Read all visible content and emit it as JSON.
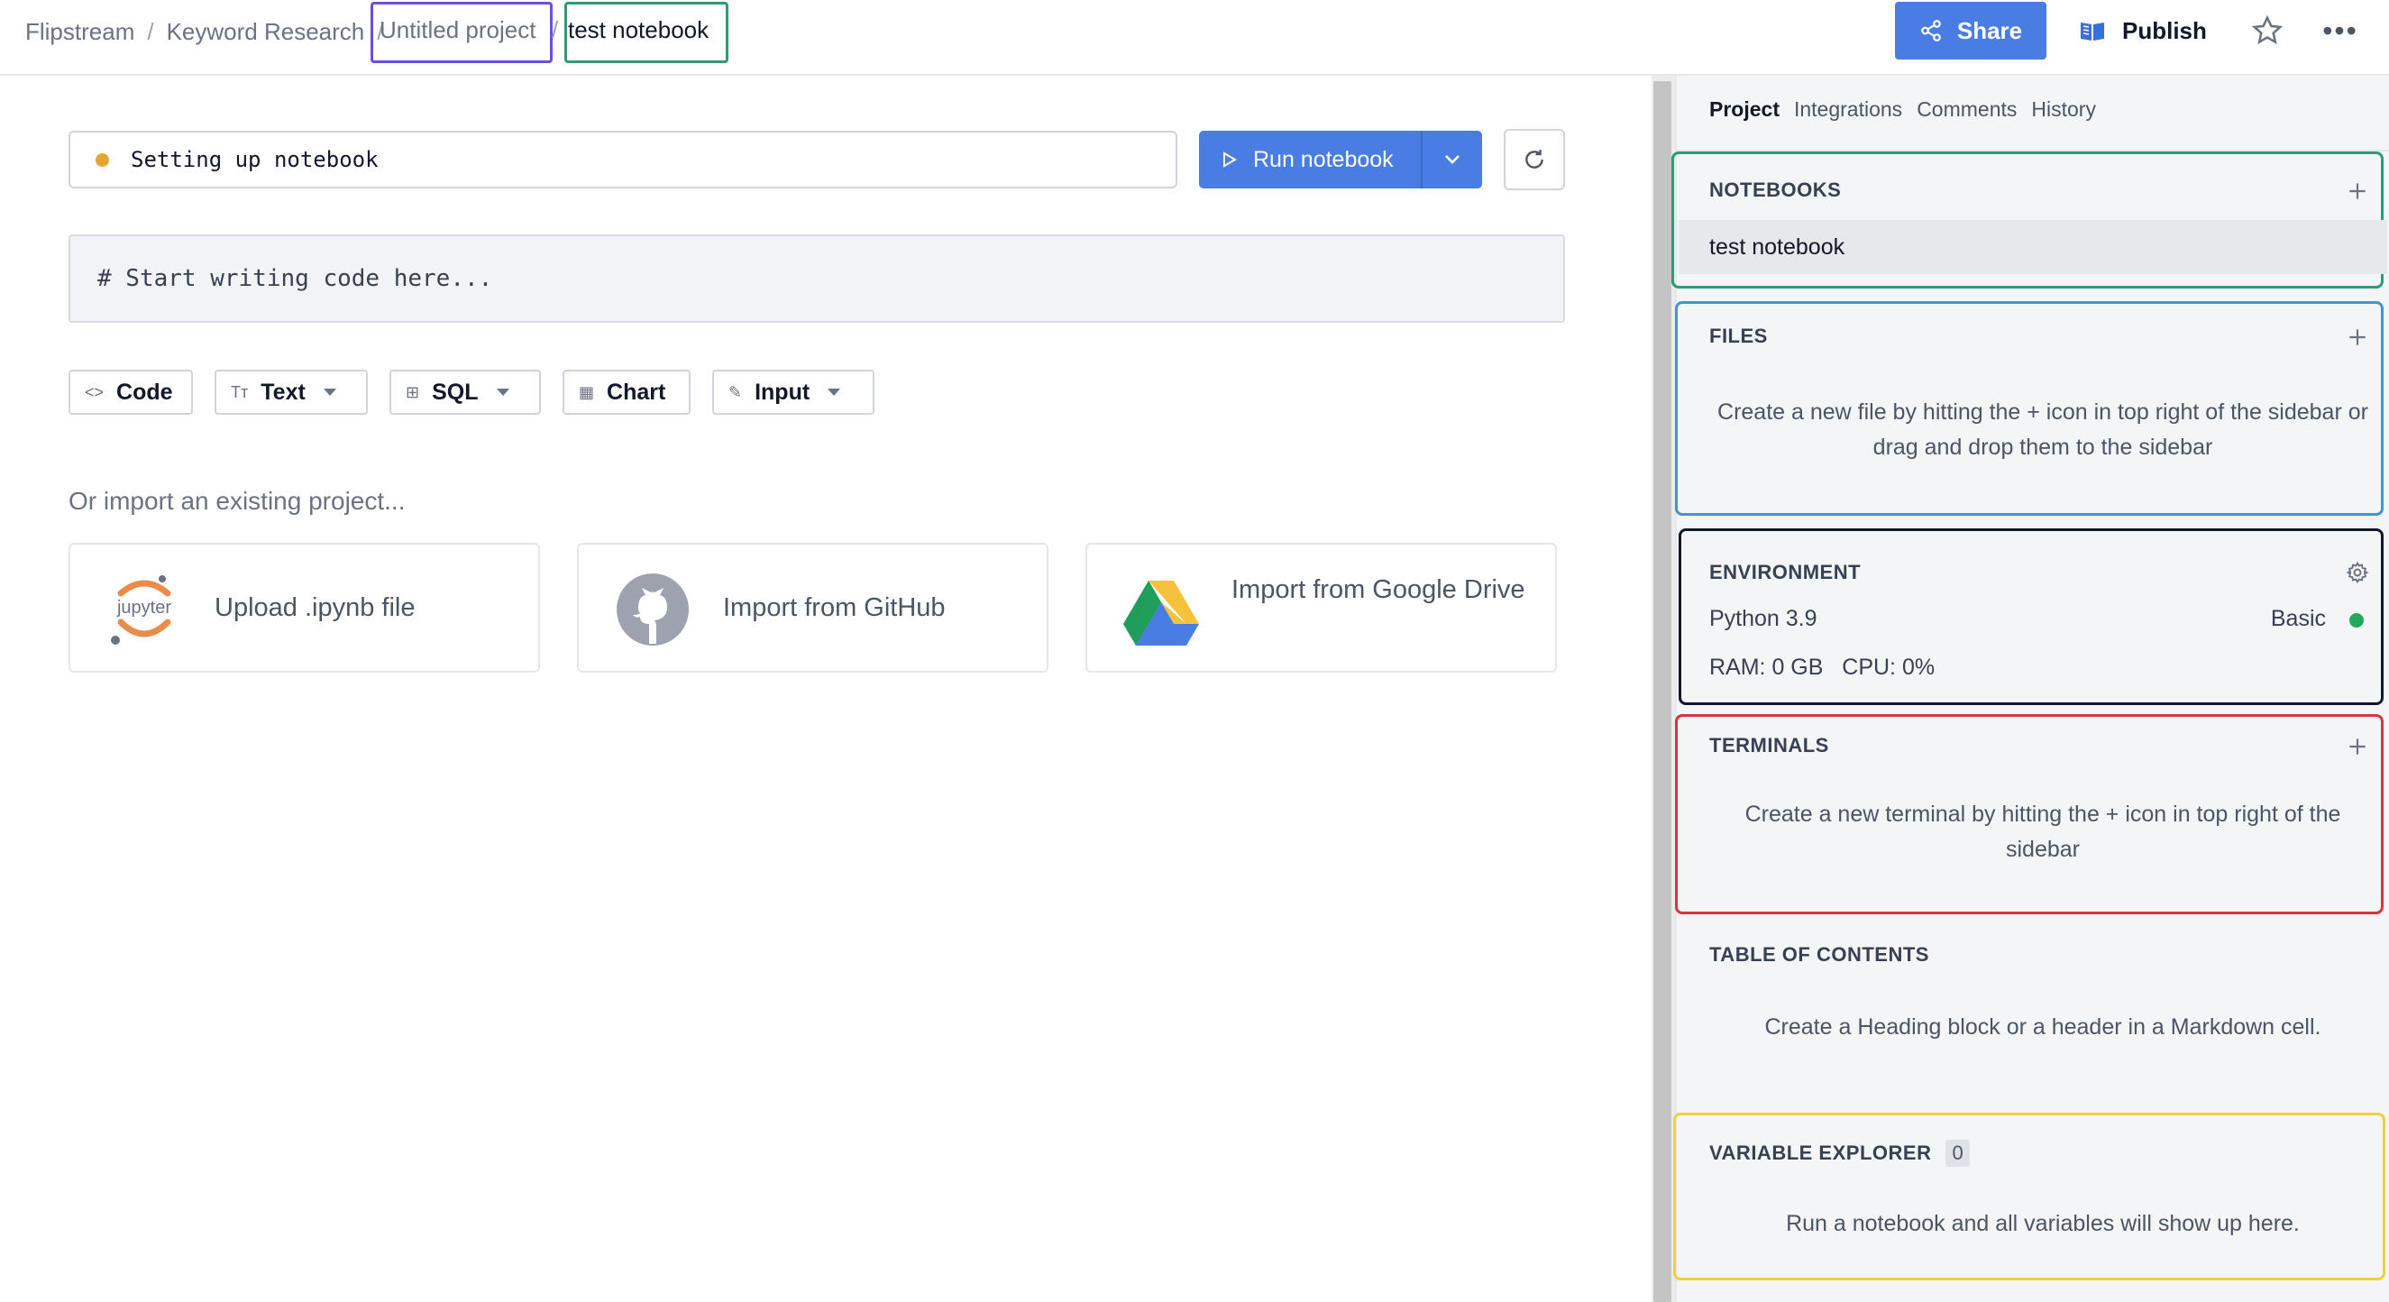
{
  "breadcrumb": {
    "items": [
      "Flipstream",
      "Keyword Research",
      "Untitled project",
      "test notebook"
    ],
    "separator": "/"
  },
  "header": {
    "share_label": "Share",
    "publish_label": "Publish",
    "more_label": "•••",
    "accent_color": "#4a7de3"
  },
  "main": {
    "status_text": "Setting up notebook",
    "status_color": "#e3a635",
    "run_label": "Run notebook",
    "code_placeholder": "# Start writing code here...",
    "cell_types": [
      {
        "label": "Code",
        "icon": "code-brackets-icon",
        "glyph": "<>"
      },
      {
        "label": "Text",
        "icon": "text-format-icon",
        "glyph": "Tт"
      },
      {
        "label": "SQL",
        "icon": "grid-icon",
        "glyph": "⊞"
      },
      {
        "label": "Chart",
        "icon": "chart-icon",
        "glyph": "▦"
      },
      {
        "label": "Input",
        "icon": "pencil-icon",
        "glyph": "✎"
      }
    ],
    "import_title": "Or import an existing project...",
    "import_options": [
      {
        "label": "Upload .ipynb file",
        "icon": "jupyter-logo",
        "logo_text": "jupyter"
      },
      {
        "label": "Import from GitHub",
        "icon": "github-logo"
      },
      {
        "label": "Import from Google Drive",
        "icon": "google-drive-logo"
      }
    ]
  },
  "sidebar": {
    "tabs": [
      "Project",
      "Integrations",
      "Comments",
      "History"
    ],
    "notebooks": {
      "title": "NOTEBOOKS",
      "items": [
        "test notebook"
      ]
    },
    "files": {
      "title": "FILES",
      "message": "Create a new file by hitting the + icon in top right of the sidebar or drag and drop them to the sidebar"
    },
    "environment": {
      "title": "ENVIRONMENT",
      "python": "Python 3.9",
      "tier": "Basic",
      "ram": "RAM: 0 GB",
      "cpu": "CPU: 0%",
      "status_color": "#22a85a"
    },
    "terminals": {
      "title": "TERMINALS",
      "message": "Create a new terminal by hitting the + icon in top right of the sidebar"
    },
    "toc": {
      "title": "TABLE OF CONTENTS",
      "message": "Create a Heading block or a header in a Markdown cell."
    },
    "variables": {
      "title": "VARIABLE EXPLORER",
      "count": "0",
      "message": "Run a notebook and all variables will show up here."
    }
  },
  "highlight_colors": {
    "purple": "#6d4ee0",
    "green": "#2f9a77",
    "blue": "#3a97d8",
    "black": "#111827",
    "red": "#d9343f",
    "yellow": "#f2cf3e"
  }
}
